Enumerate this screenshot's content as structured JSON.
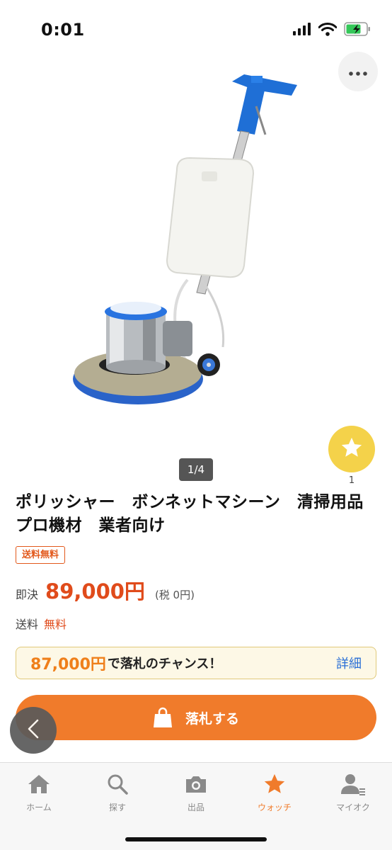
{
  "status_bar": {
    "time": "0:01",
    "icons": [
      "cellular-signal-icon",
      "wifi-icon",
      "battery-charging-icon"
    ]
  },
  "header": {
    "more_icon": "more-horizontal-icon"
  },
  "product": {
    "image_counter": "1/4",
    "watch_count": "1",
    "title": "ポリッシャー　ボンネットマシーン　清掃用品　プロ機材　業者向け",
    "shipping_badge": "送料無料",
    "price_label": "即決",
    "price_value": "89,000円",
    "price_tax": "(税 0円)",
    "shipping_label": "送料",
    "shipping_value": "無料"
  },
  "chance": {
    "price": "87,000円",
    "text": "で落札のチャンス！",
    "detail_link": "詳細"
  },
  "bid_button": {
    "label": "落札する",
    "icon": "shopping-bag-icon"
  },
  "tab_bar": {
    "tabs": [
      {
        "label": "ホーム",
        "icon": "home-icon",
        "active": false
      },
      {
        "label": "探す",
        "icon": "search-icon",
        "active": false
      },
      {
        "label": "出品",
        "icon": "camera-icon",
        "active": false
      },
      {
        "label": "ウォッチ",
        "icon": "star-icon",
        "active": true
      },
      {
        "label": "マイオク",
        "icon": "user-menu-icon",
        "active": false
      }
    ]
  },
  "colors": {
    "accent_orange": "#f07b2b",
    "price_red": "#e04b1b",
    "link_blue": "#2a6fd6",
    "star_yellow": "#f4d24a"
  }
}
